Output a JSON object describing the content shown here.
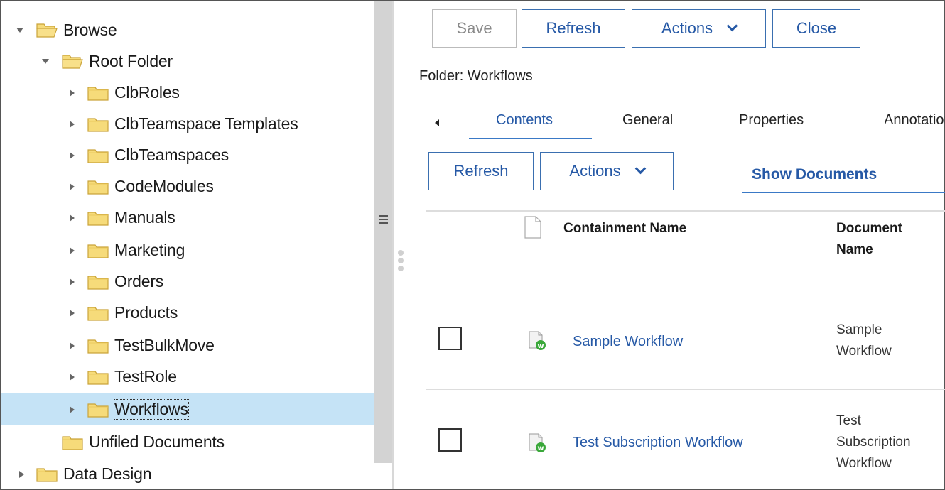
{
  "tree": {
    "items": [
      {
        "label": "Browse"
      },
      {
        "label": "Root Folder"
      },
      {
        "label": "ClbRoles"
      },
      {
        "label": "ClbTeamspace Templates"
      },
      {
        "label": "ClbTeamspaces"
      },
      {
        "label": "CodeModules"
      },
      {
        "label": "Manuals"
      },
      {
        "label": "Marketing"
      },
      {
        "label": "Orders"
      },
      {
        "label": "Products"
      },
      {
        "label": "TestBulkMove"
      },
      {
        "label": "TestRole"
      },
      {
        "label": "Workflows"
      },
      {
        "label": "Unfiled Documents"
      },
      {
        "label": "Data Design"
      }
    ]
  },
  "toolbar": {
    "save": "Save",
    "refresh": "Refresh",
    "actions": "Actions",
    "close": "Close"
  },
  "folder_label": "Folder: Workflows",
  "tabs": [
    "Contents",
    "General",
    "Properties",
    "Annotations"
  ],
  "contents": {
    "refresh": "Refresh",
    "actions": "Actions",
    "show_documents": "Show Documents",
    "columns": {
      "containment": "Containment Name",
      "document_line1": "Document",
      "document_line2": "Name"
    },
    "rows": [
      {
        "containment_name": "Sample Workflow",
        "doc_name_lines": [
          "Sample",
          "Workflow"
        ]
      },
      {
        "containment_name": "Test Subscription Workflow",
        "doc_name_lines": [
          "Test",
          "Subscription",
          "Workflow"
        ]
      }
    ]
  },
  "colors": {
    "accent": "#2659a6",
    "selection": "#c5e3f6",
    "folder": "#f6db7a"
  }
}
